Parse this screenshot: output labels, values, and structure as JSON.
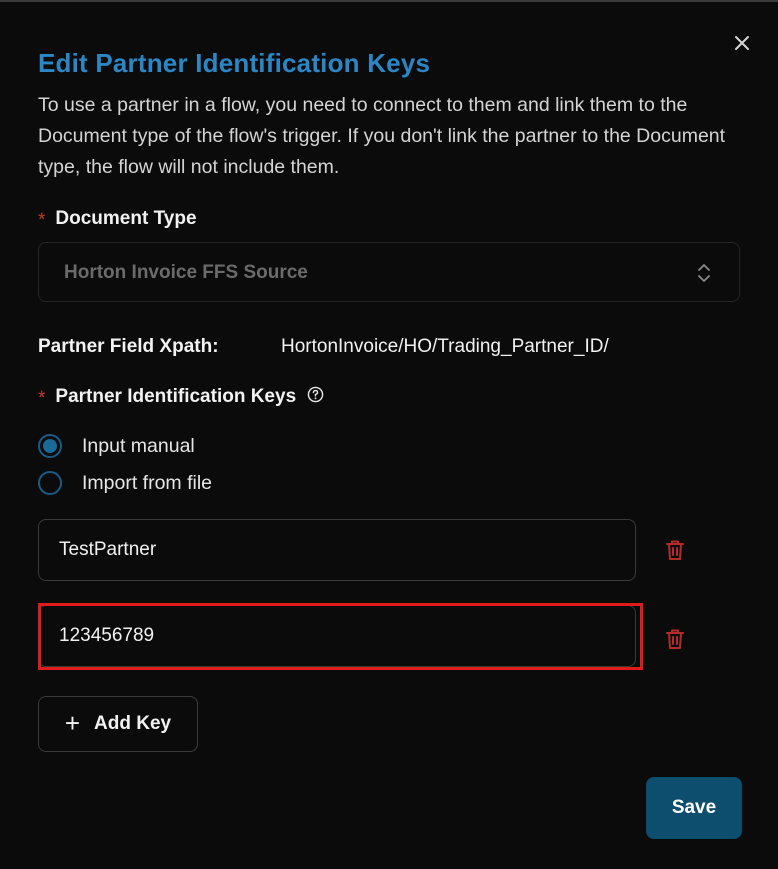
{
  "dialog": {
    "title": "Edit Partner Identification Keys",
    "description": "To use a partner in a flow, you need to connect to them and link them to the Document type of the flow's trigger. If you don't link the partner to the Document type, the flow will not include them.",
    "close_icon": "close-icon"
  },
  "document_type": {
    "required_mark": "*",
    "label": "Document Type",
    "selected_value": "Horton Invoice FFS Source",
    "icon": "chevron-up-down-icon"
  },
  "xpath": {
    "label": "Partner Field Xpath:",
    "value": "HortonInvoice/HO/Trading_Partner_ID/"
  },
  "keys_section": {
    "required_mark": "*",
    "label": "Partner Identification Keys",
    "help_icon": "help-circle-icon",
    "options": [
      {
        "label": "Input manual",
        "checked": true
      },
      {
        "label": "Import from file",
        "checked": false
      }
    ],
    "keys": [
      {
        "value": "TestPartner",
        "highlighted": false
      },
      {
        "value": "123456789",
        "highlighted": true
      }
    ],
    "delete_icon": "trash-icon",
    "add_label": "Add Key",
    "add_icon": "plus-icon"
  },
  "actions": {
    "save_label": "Save"
  },
  "colors": {
    "title": "#2a86c4",
    "required": "#c0392b",
    "delete_icon": "#b52a2a",
    "highlight": "#e11b1b",
    "primary_button": "#0d4e6f",
    "radio": "#1a6a98"
  }
}
